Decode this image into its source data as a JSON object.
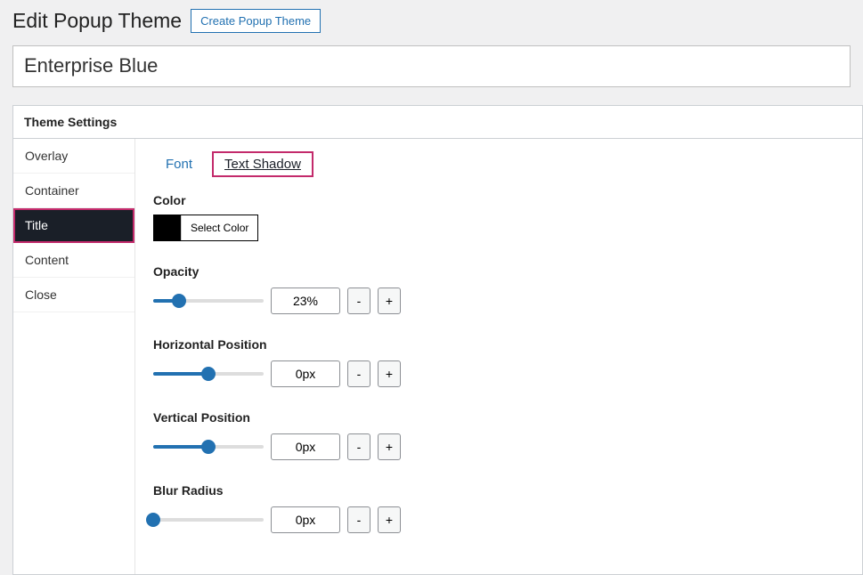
{
  "header": {
    "title": "Edit Popup Theme",
    "create_btn": "Create Popup Theme"
  },
  "theme_name": "Enterprise Blue",
  "panel": {
    "title": "Theme Settings"
  },
  "sidebar": {
    "items": [
      {
        "label": "Overlay",
        "active": false
      },
      {
        "label": "Container",
        "active": false
      },
      {
        "label": "Title",
        "active": true
      },
      {
        "label": "Content",
        "active": false
      },
      {
        "label": "Close",
        "active": false
      }
    ]
  },
  "tabs": [
    {
      "label": "Font",
      "active": false
    },
    {
      "label": "Text Shadow",
      "active": true
    }
  ],
  "sections": {
    "color": {
      "label": "Color",
      "button": "Select Color",
      "value": "#000000"
    },
    "sliders": [
      {
        "label": "Opacity",
        "value": "23%",
        "fill": 23
      },
      {
        "label": "Horizontal Position",
        "value": "0px",
        "fill": 50
      },
      {
        "label": "Vertical Position",
        "value": "0px",
        "fill": 50
      },
      {
        "label": "Blur Radius",
        "value": "0px",
        "fill": 0
      }
    ]
  },
  "step": {
    "minus": "-",
    "plus": "+"
  }
}
